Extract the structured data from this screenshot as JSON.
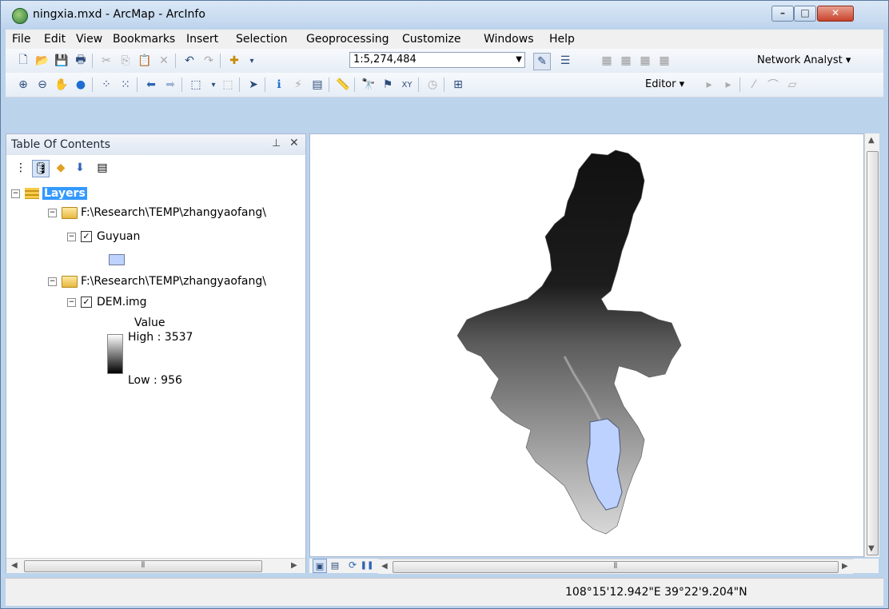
{
  "window": {
    "title": "ningxia.mxd - ArcMap - ArcInfo",
    "min": "–",
    "max": "□",
    "close": "✕"
  },
  "menu": [
    "File",
    "Edit",
    "View",
    "Bookmarks",
    "Insert",
    "Selection",
    "Geoprocessing",
    "Customize",
    "Windows",
    "Help"
  ],
  "toolbar": {
    "scale_value": "1:5,274,484",
    "network_analyst_label": "Network Analyst ▾",
    "editor_label": "Editor ▾"
  },
  "toc": {
    "title": "Table Of Contents",
    "pin": "⊥",
    "close": "✕",
    "layers_label": "Layers",
    "group1_path": "F:\\Research\\TEMP\\zhangyaofang\\",
    "guyuan_label": "Guyuan",
    "group2_path": "F:\\Research\\TEMP\\zhangyaofang\\",
    "dem_label": "DEM.img",
    "legend_value_label": "Value",
    "legend_high": "High : 3537",
    "legend_low": "Low : 956"
  },
  "status": {
    "coordinates": "108°15'12.942\"E  39°22'9.204\"N"
  },
  "colors": {
    "selection": "#3399ff",
    "polygon_fill": "#bed2ff"
  }
}
